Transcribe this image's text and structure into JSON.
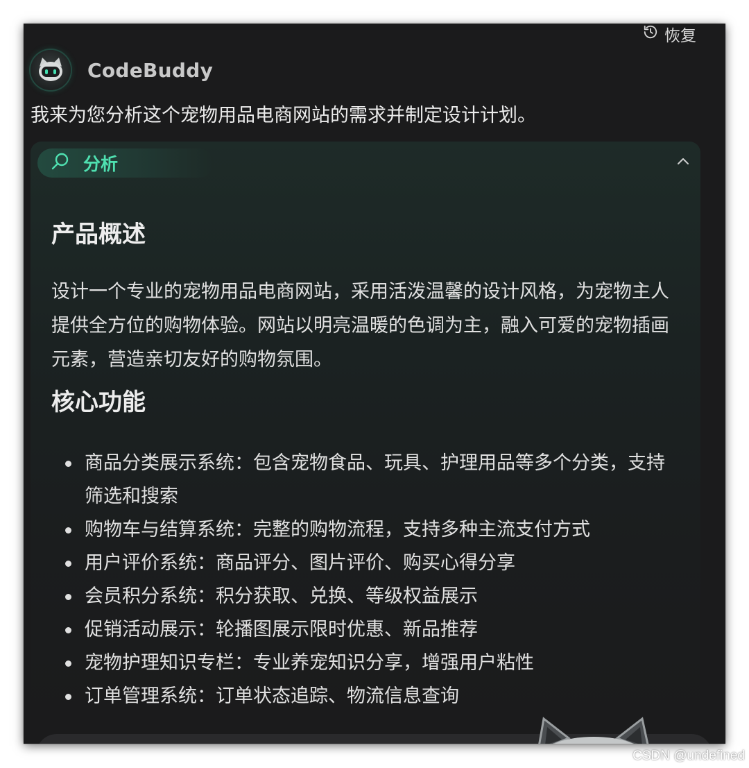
{
  "toolbar": {
    "restore_label": "恢复",
    "restore_icon": "history-icon"
  },
  "agent": {
    "name": "CodeBuddy",
    "avatar_icon": "robot-cat-avatar"
  },
  "message": {
    "intro": "我来为您分析这个宠物用品电商网站的需求并制定设计计划。",
    "analysis_tag": {
      "label": "分析",
      "icon": "search-icon",
      "expanded": true
    }
  },
  "sections": {
    "overview_title": "产品概述",
    "overview_text": "设计一个专业的宠物用品电商网站，采用活泼温馨的设计风格，为宠物主人提供全方位的购物体验。网站以明亮温暖的色调为主，融入可爱的宠物插画元素，营造亲切友好的购物氛围。",
    "features_title": "核心功能",
    "features": [
      "商品分类展示系统：包含宠物食品、玩具、护理用品等多个分类，支持筛选和搜索",
      "购物车与结算系统：完整的购物流程，支持多种主流支付方式",
      "用户评价系统：商品评分、图片评价、购买心得分享",
      "会员积分系统：积分获取、兑换、等级权益展示",
      "促销活动展示：轮播图展示限时优惠、新品推荐",
      "宠物护理知识专栏：专业养宠知识分享，增强用户粘性",
      "订单管理系统：订单状态追踪、物流信息查询"
    ]
  },
  "watermark": "CSDN @undefined",
  "colors": {
    "background": "#1b1b1c",
    "accent": "#4fe0b0",
    "text": "#e0e0e0"
  }
}
